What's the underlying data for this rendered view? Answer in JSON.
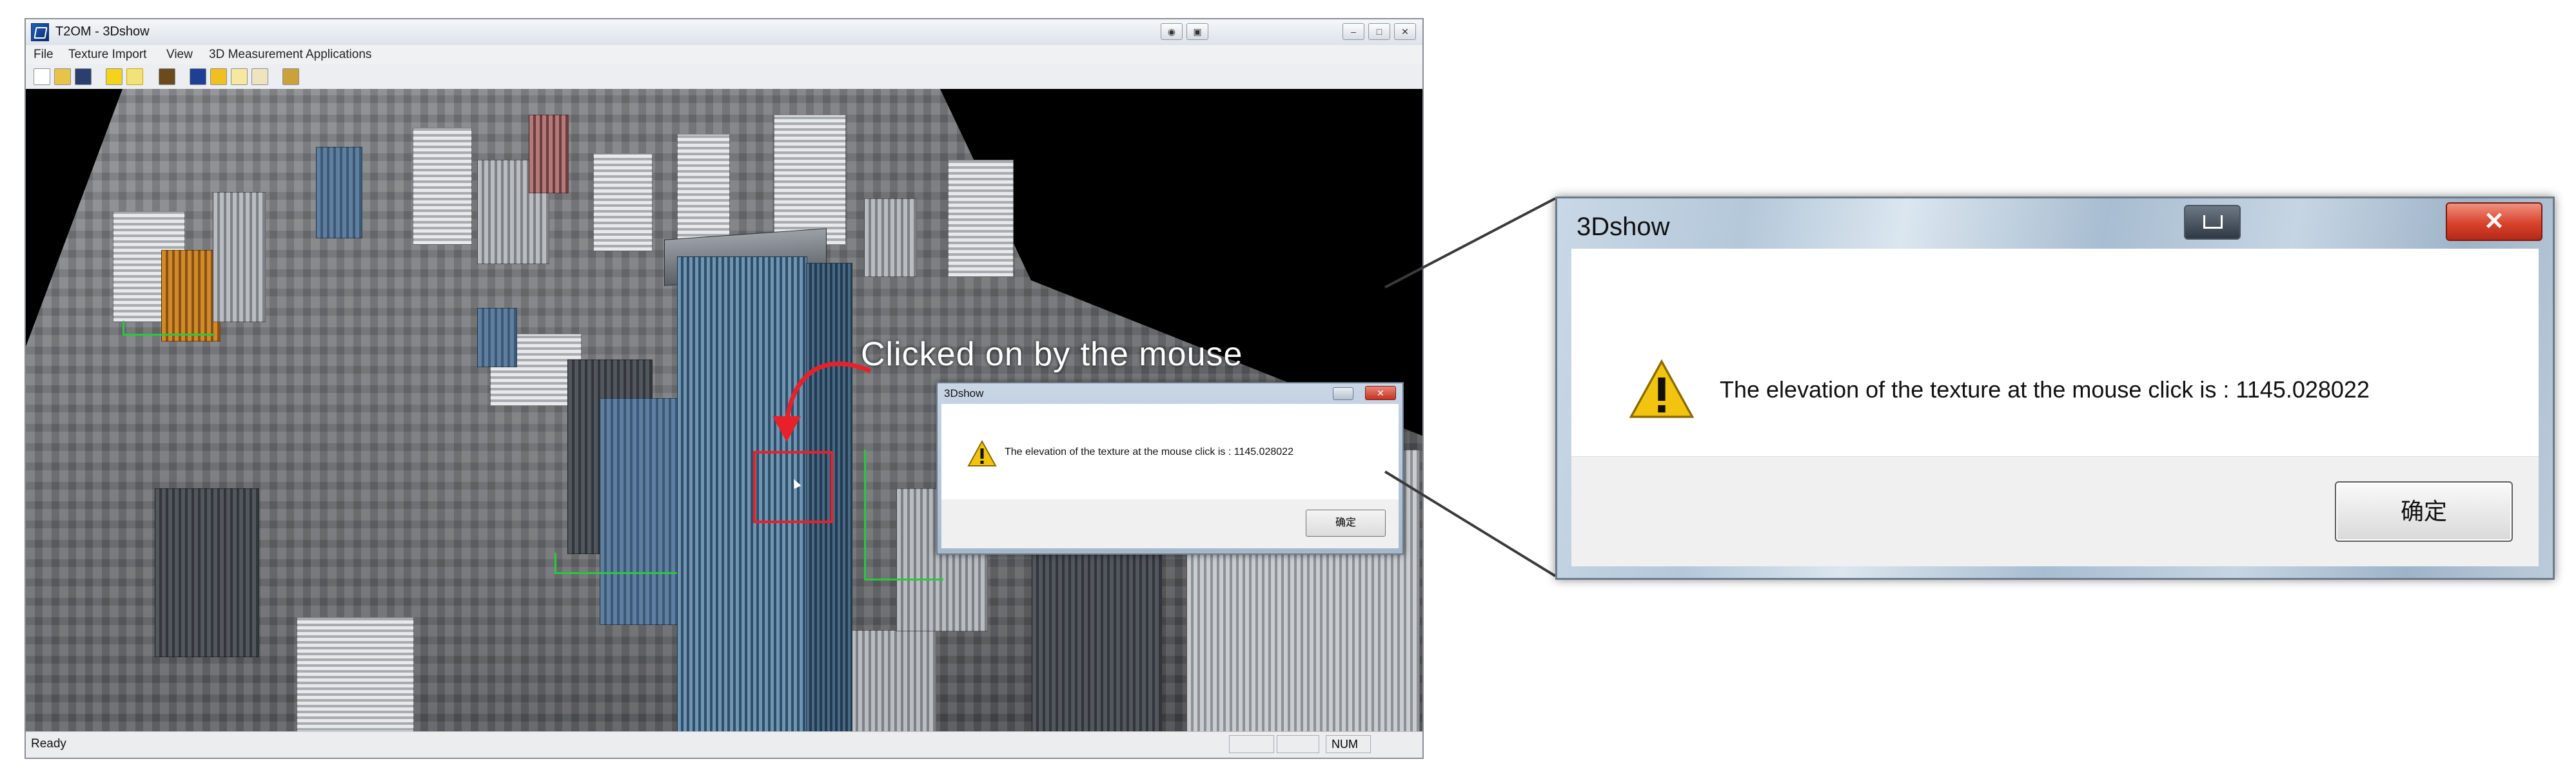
{
  "app": {
    "title": "T2OM - 3Dshow",
    "menu": [
      "File",
      "Texture Import",
      "View",
      "3D Measurement Applications"
    ],
    "status_text": "Ready",
    "status_num": "NUM",
    "annotation": "Clicked on by the mouse"
  },
  "dialog": {
    "title": "3Dshow",
    "message": "The elevation of the texture at the mouse click is : 1145.028022",
    "ok_label": "确定",
    "close_glyph": "✕",
    "icon": "warning-icon"
  },
  "colors": {
    "highlight": "#e8202a",
    "warning_fill": "#f2c40f",
    "close_button": "#d8432c",
    "footprint_edges": "#27c93f"
  }
}
